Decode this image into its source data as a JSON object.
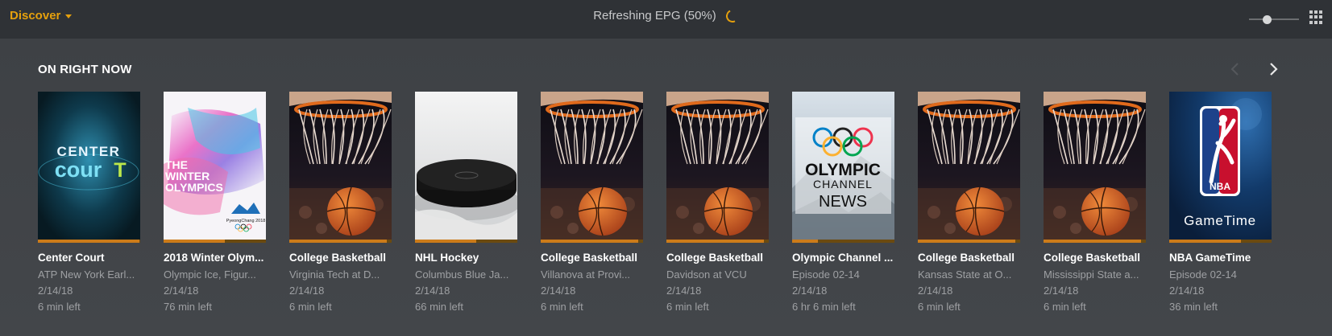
{
  "header": {
    "discover_label": "Discover",
    "status_text": "Refreshing EPG (50%)",
    "poster_size_slider": 0.35
  },
  "section": {
    "title": "ON RIGHT NOW"
  },
  "cards": [
    {
      "title": "Center Court",
      "subtitle": "ATP New York Earl...",
      "date": "2/14/18",
      "time_left": "6 min left",
      "poster": "center-court",
      "poster_text": [
        "CENTER",
        "cour",
        "T"
      ],
      "progress": 0.99
    },
    {
      "title": "2018 Winter Olym...",
      "subtitle": "Olympic Ice, Figur...",
      "date": "2/14/18",
      "time_left": "76 min left",
      "poster": "winter-olympics",
      "poster_text": [
        "THE",
        "WINTER",
        "OLYMPICS",
        "PyeongChang 2018"
      ],
      "progress": 0.6
    },
    {
      "title": "College Basketball",
      "subtitle": "Virginia Tech at D...",
      "date": "2/14/18",
      "time_left": "6 min left",
      "poster": "basketball",
      "poster_text": [],
      "progress": 0.95
    },
    {
      "title": "NHL Hockey",
      "subtitle": "Columbus Blue Ja...",
      "date": "2/14/18",
      "time_left": "66 min left",
      "poster": "hockey",
      "poster_text": [],
      "progress": 0.6
    },
    {
      "title": "College Basketball",
      "subtitle": "Villanova at Provi...",
      "date": "2/14/18",
      "time_left": "6 min left",
      "poster": "basketball",
      "poster_text": [],
      "progress": 0.95
    },
    {
      "title": "College Basketball",
      "subtitle": "Davidson at VCU",
      "date": "2/14/18",
      "time_left": "6 min left",
      "poster": "basketball",
      "poster_text": [],
      "progress": 0.95
    },
    {
      "title": "Olympic Channel ...",
      "subtitle": "Episode 02-14",
      "date": "2/14/18",
      "time_left": "6 hr 6 min left",
      "poster": "olympic-news",
      "poster_text": [
        "OLYMPIC",
        "CHANNEL",
        "NEWS"
      ],
      "progress": 0.25
    },
    {
      "title": "College Basketball",
      "subtitle": "Kansas State at O...",
      "date": "2/14/18",
      "time_left": "6 min left",
      "poster": "basketball",
      "poster_text": [],
      "progress": 0.95
    },
    {
      "title": "College Basketball",
      "subtitle": "Mississippi State a...",
      "date": "2/14/18",
      "time_left": "6 min left",
      "poster": "basketball",
      "poster_text": [],
      "progress": 0.95
    },
    {
      "title": "NBA GameTime",
      "subtitle": "Episode 02-14",
      "date": "2/14/18",
      "time_left": "36 min left",
      "poster": "nba-gametime",
      "poster_text": [
        "NBA",
        "GameTime"
      ],
      "progress": 0.7
    }
  ],
  "icons": {
    "dropdown": "chevron-down-icon",
    "spinner": "loading-spinner-icon",
    "apps": "grid-icon",
    "prev": "chevron-left-icon",
    "next": "chevron-right-icon"
  },
  "colors": {
    "accent": "#e5a00d",
    "progress": "#cc7b19",
    "background": "#3f4246",
    "topbar": "#2f3236"
  }
}
